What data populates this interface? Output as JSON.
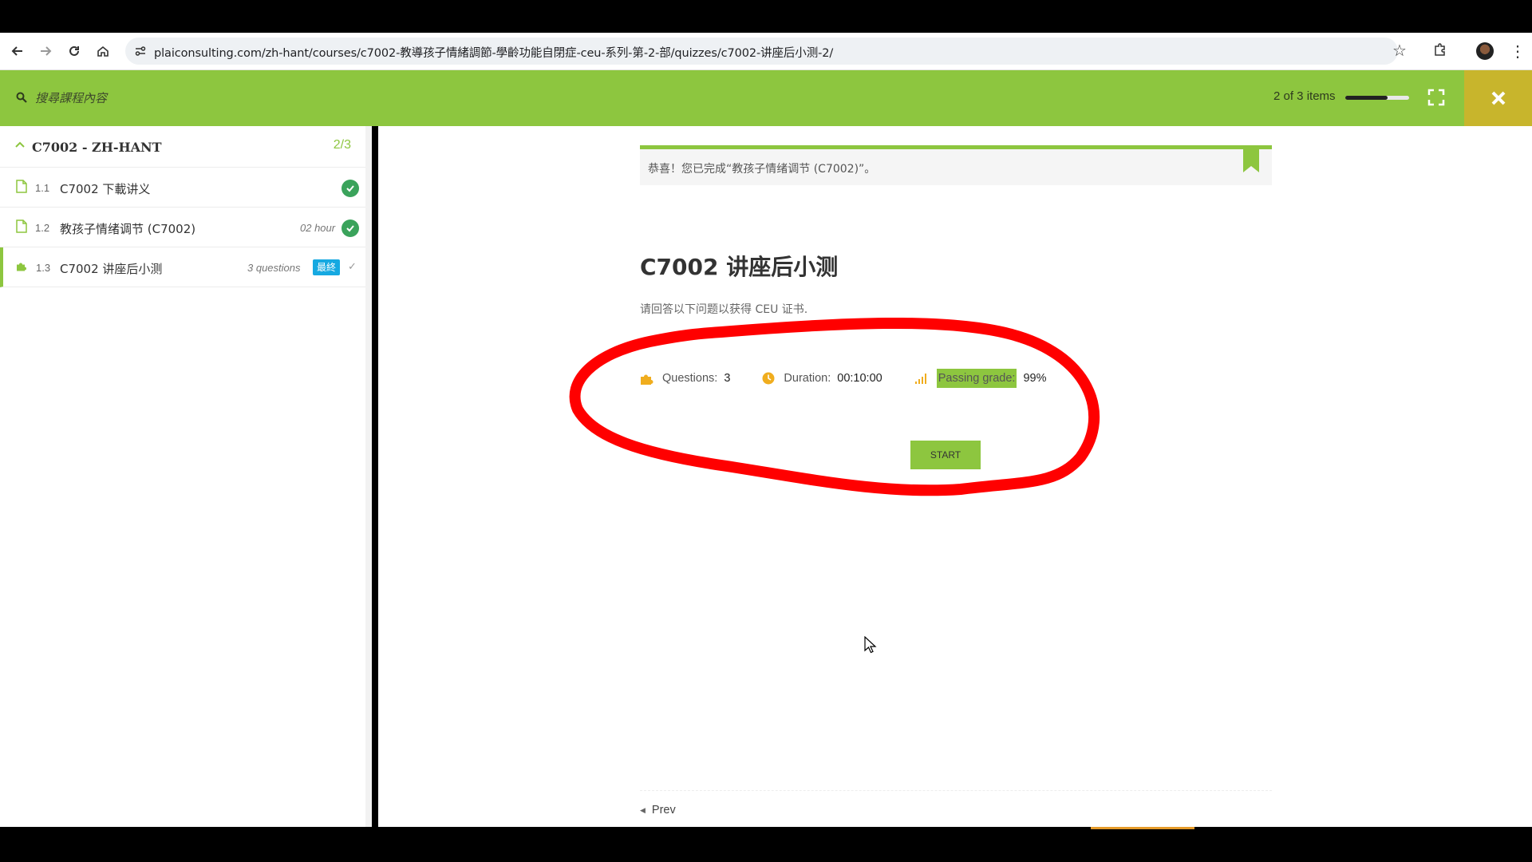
{
  "browser": {
    "url": "plaiconsulting.com/zh-hant/courses/c7002-教導孩子情緒調節-學齡功能自閉症-ceu-系列-第-2-部/quizzes/c7002-讲座后小测-2/",
    "icons": [
      "back-arrow-icon",
      "forward-arrow-icon",
      "reload-icon",
      "home-icon",
      "site-settings-icon",
      "bookmark-star-icon",
      "extensions-icon",
      "profile-avatar",
      "kebab-menu-icon"
    ]
  },
  "header": {
    "search_placeholder": "搜尋課程內容",
    "items_count": "2 of 3 items",
    "progress_fraction": 0.667,
    "accent_color": "#8dc63f",
    "close_bg_color": "#c8b52c"
  },
  "sidebar": {
    "section_title": "C7002 - ZH-HANT",
    "section_count": "2/3",
    "lessons": [
      {
        "number": "1.1",
        "name": "C7002 下載讲义",
        "meta": "",
        "type": "document",
        "completed": true
      },
      {
        "number": "1.2",
        "name": "教孩子情绪调节 (C7002)",
        "meta": "02 hour",
        "type": "document",
        "completed": true
      },
      {
        "number": "1.3",
        "name": "C7002 讲座后小测",
        "meta": "3 questions",
        "type": "quiz",
        "badge": "最終",
        "completed": false
      }
    ]
  },
  "main": {
    "notice": "恭喜！您已完成“教孩子情绪调节 (C7002)”。",
    "quiz_title": "C7002 讲座后小测",
    "quiz_description": "请回答以下问题以获得 CEU 证书.",
    "meta": {
      "questions_label": "Questions:",
      "questions_value": "3",
      "duration_label": "Duration:",
      "duration_value": "00:10:00",
      "passing_label": "Passing grade:",
      "passing_value": "99%"
    },
    "start_label": "START",
    "prev_label": "Prev"
  }
}
